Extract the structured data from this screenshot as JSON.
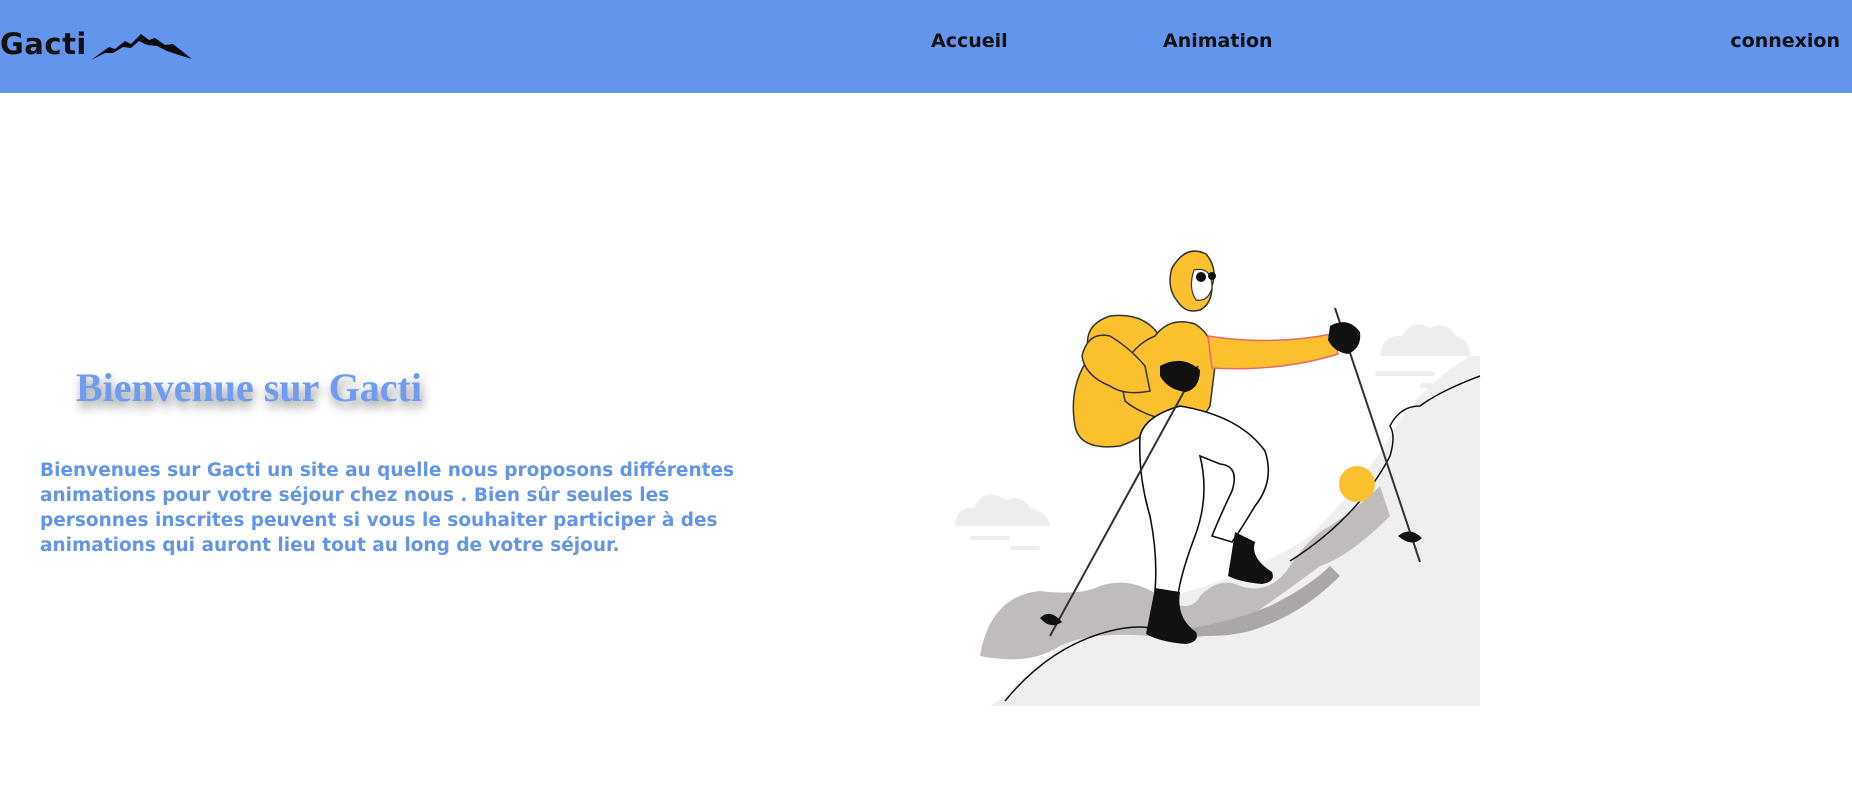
{
  "navbar": {
    "brand": "Gacti",
    "links": [
      "Accueil",
      "Animation"
    ],
    "login": "connexion",
    "background": "#6495ed"
  },
  "hero": {
    "title": "Bienvenue sur Gacti",
    "text": "Bienvenues sur Gacti un site au quelle nous proposons différentes animations pour votre séjour chez nous . Bien sûr seules les personnes inscrites peuvent si vous le souhaiter participer à des animations qui auront lieu tout au long de votre séjour.",
    "accent_color": "#6495ed"
  },
  "illustration": {
    "icon": "hiker-illustration",
    "jacket_color": "#fbc02d"
  }
}
